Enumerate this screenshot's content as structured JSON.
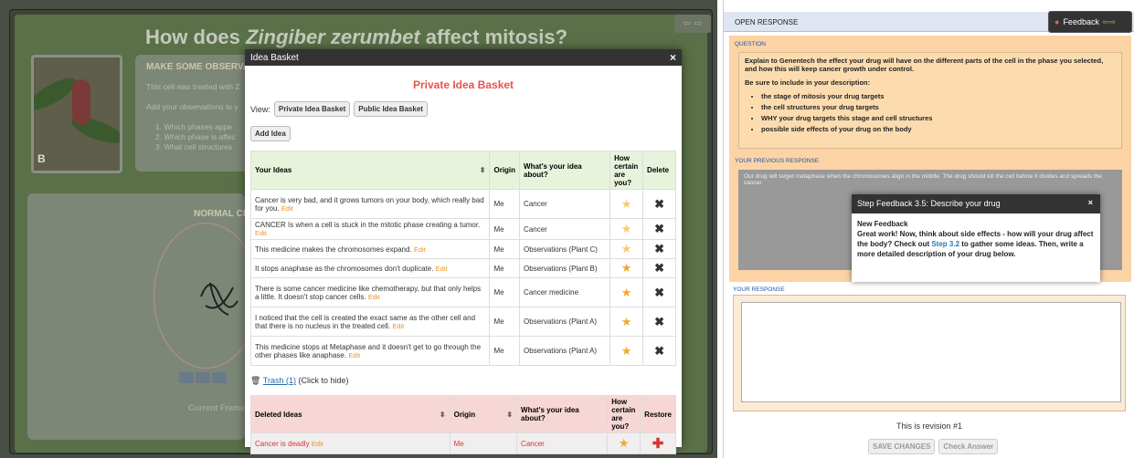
{
  "left": {
    "title_prefix": "How does ",
    "title_italic": "Zingiber zerumbet",
    "title_suffix": " affect mitosis?",
    "nav_arrows": "⇦ ⇨",
    "photo_label": "B",
    "obs_title": "MAKE SOME OBSERVAT",
    "obs_line1": "This cell was treated with Z",
    "obs_line2": "Add your observations to y",
    "obs_item1": "1. Which phases appe",
    "obs_item2": "2. Which phase is affec",
    "obs_item3": "3. What cell structures",
    "cell_title": "NORMAL CE",
    "current_frame": "Current Frame"
  },
  "modal": {
    "title": "Idea Basket",
    "close": "×",
    "basket_title": "Private Idea Basket",
    "view_label": "View:",
    "private_btn": "Private Idea Basket",
    "public_btn": "Public Idea Basket",
    "add_btn": "Add Idea",
    "columns": {
      "ideas": "Your Ideas",
      "origin": "Origin",
      "about": "What's your idea about?",
      "certain": "How certain are you?",
      "delete": "Delete"
    },
    "edit_label": "Edit",
    "ideas": [
      {
        "text": "Cancer is very bad, and it grows tumors on your body, which really bad for you.",
        "origin": "Me",
        "about": "Cancer"
      },
      {
        "text": "CANCER Is when a cell is stuck in the mitotic phase creating a tumor.",
        "origin": "Me",
        "about": "Cancer"
      },
      {
        "text": "This medicine makes the chromosomes expand.",
        "origin": "Me",
        "about": "Observations (Plant C)"
      },
      {
        "text": "It stops anaphase as the chromosomes don't duplicate.",
        "origin": "Me",
        "about": "Observations (Plant B)"
      },
      {
        "text": "There is some cancer medicine like chemotherapy, but that only helps a little. It doesn't stop cancer cells.",
        "origin": "Me",
        "about": "Cancer medicine"
      },
      {
        "text": "I noticed that the cell is created the exact same as the other cell and that there is no nucleus in the treated cell.",
        "origin": "Me",
        "about": "Observations (Plant A)"
      },
      {
        "text": "This medicine stops at Metaphase and it doesn't get to go through the other phases like anaphase.",
        "origin": "Me",
        "about": "Observations (Plant A)"
      }
    ],
    "trash_link": "Trash (1)",
    "trash_hint": "(Click to hide)",
    "deleted_columns": {
      "ideas": "Deleted Ideas",
      "origin": "Origin",
      "about": "What's your idea about?",
      "certain": "How certain are you?",
      "restore": "Restore"
    },
    "deleted": [
      {
        "text": "Cancer is deadly",
        "origin": "Me",
        "about": "Cancer"
      }
    ]
  },
  "right": {
    "header": "OPEN RESPONSE",
    "feedback_btn": "Feedback",
    "question_label": "QUESTION",
    "question_text": "Explain to Genentech the effect your drug will have on the different parts of the cell in the phase you selected, and how this will keep cancer growth under control.",
    "question_sub": "Be sure to include in your description:",
    "bullets": [
      "the stage of mitosis your drug targets",
      "the cell structures your drug targets",
      "WHY your drug targets this stage and cell structures",
      "possible side effects of your drug on the body"
    ],
    "prev_label": "YOUR PREVIOUS RESPONSE",
    "prev_text": "Our drug will target metaphase when the chromosomes align in the middle. The drug should kill the cell before it divides and spreads the cancer.",
    "popup_title": "Step Feedback 3.5: Describe your drug",
    "popup_close": "×",
    "popup_new": "New Feedback",
    "popup_text1": "Great work! Now, think about side effects - how will your drug affect the body? Check out ",
    "popup_link": "Step 3.2",
    "popup_text2": " to gather some ideas. Then, write a more detailed description of your drug below.",
    "response_label": "YOUR RESPONSE",
    "response_value": "",
    "revision": "This is revision #1",
    "save_btn": "SAVE CHANGES",
    "check_btn": "Check Answer"
  }
}
